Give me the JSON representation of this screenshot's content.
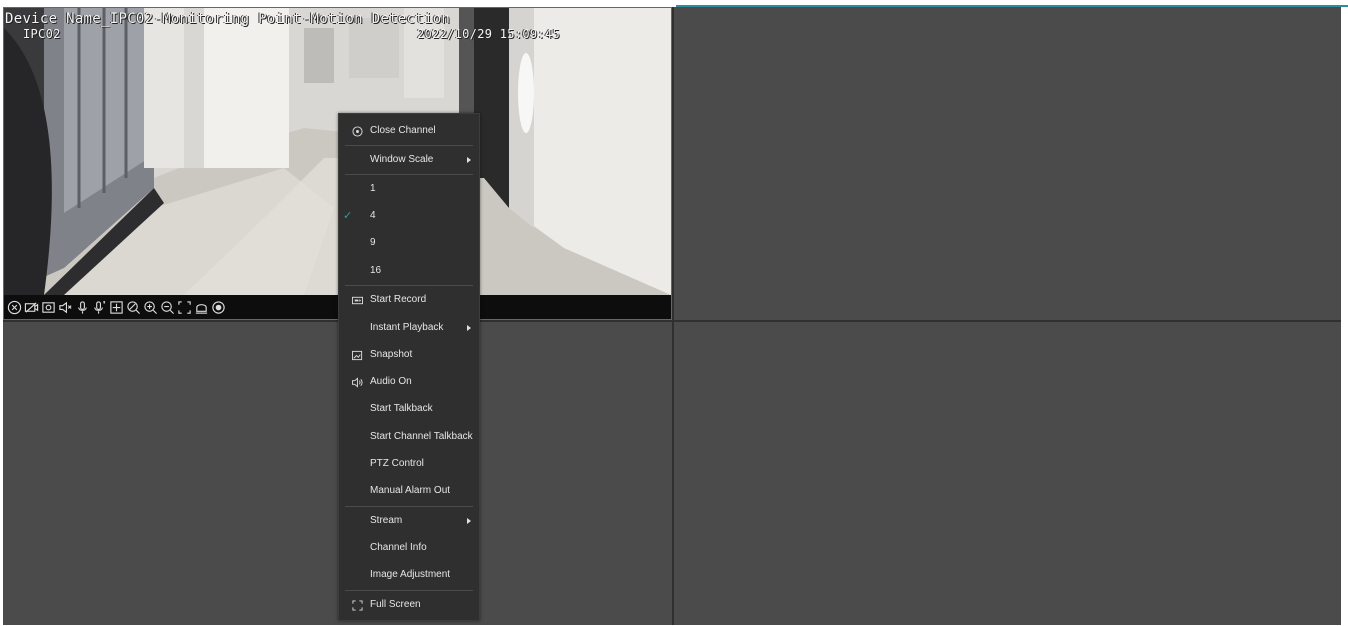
{
  "video": {
    "device_name": "Device Name_IPC02-Monitoring Point-Motion Detection",
    "camera": "IPC02",
    "timestamp": "2022/10/29 15:09:45"
  },
  "toolbar_icons": [
    "close-icon",
    "record-icon",
    "snapshot-icon",
    "audio-off-icon",
    "mic-icon",
    "channel-mic-icon",
    "ptz-icon",
    "zoom-3d-icon",
    "zoom-in-icon",
    "zoom-out-icon",
    "fullscreen-icon",
    "alarm-out-icon",
    "stream-icon"
  ],
  "menu": {
    "close_channel": "Close Channel",
    "window_scale": "Window Scale",
    "scale_options": [
      "1",
      "4",
      "9",
      "16"
    ],
    "selected_scale": "4",
    "start_record": "Start Record",
    "instant_playback": "Instant Playback",
    "snapshot": "Snapshot",
    "audio_on": "Audio On",
    "start_talkback": "Start Talkback",
    "start_channel_talkback": "Start Channel Talkback",
    "ptz_control": "PTZ Control",
    "manual_alarm_out": "Manual Alarm Out",
    "stream": "Stream",
    "channel_info": "Channel Info",
    "image_adjustment": "Image Adjustment",
    "full_screen": "Full Screen"
  },
  "colors": {
    "selected_border": "#d33b2b",
    "accent_check": "#2aa198",
    "empty_pane": "#4b4b4b",
    "menu_bg": "#2f2f2f"
  }
}
